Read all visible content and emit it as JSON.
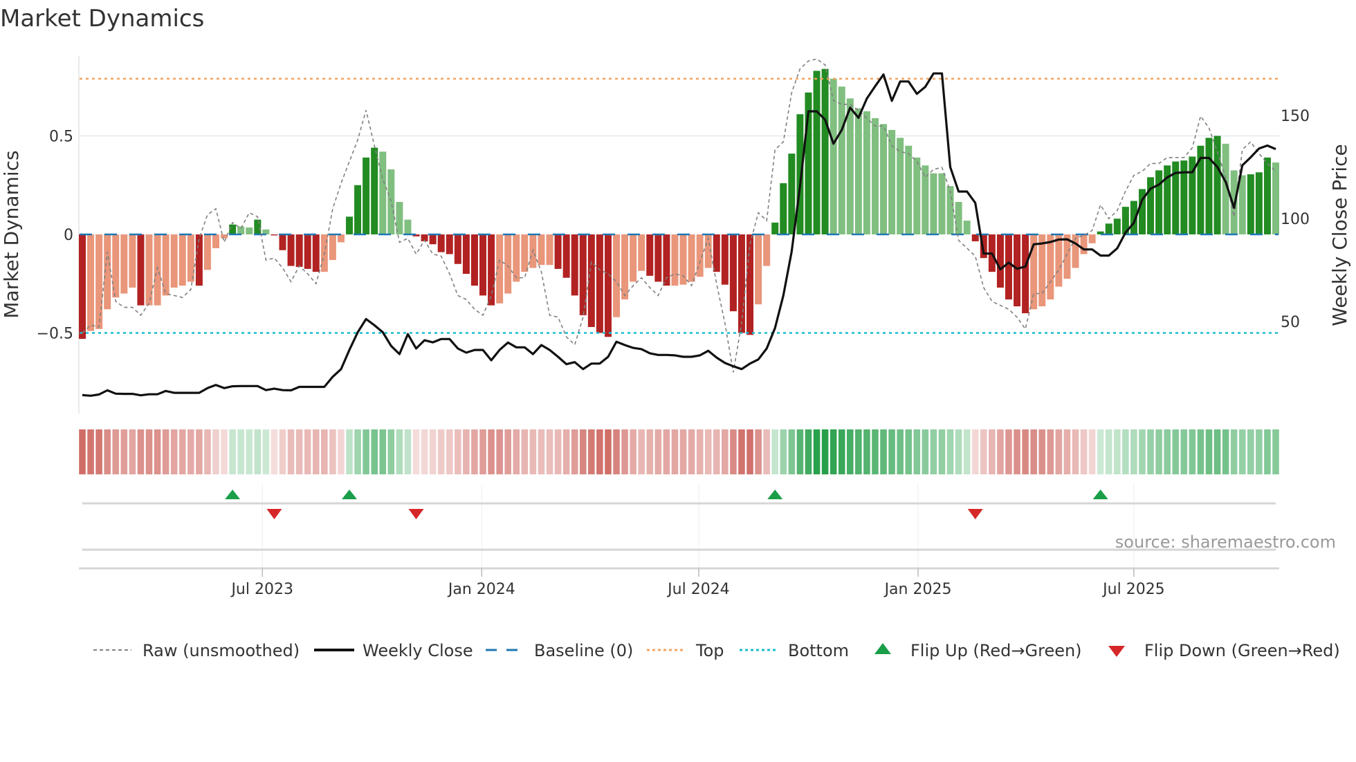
{
  "title": "Market Dynamics",
  "source": "source: sharemaestro.com",
  "colors": {
    "dark_red": "#b22222",
    "light_red": "#e9967a",
    "dark_green": "#228b22",
    "light_green": "#80bf80",
    "raw": "#808080",
    "close": "#111111",
    "baseline": "#1f77b4",
    "top": "#f4a460",
    "bottom": "#17becf",
    "flip_up": "#1a9e48",
    "flip_down": "#d62728"
  },
  "legend": {
    "raw": "Raw (unsmoothed)",
    "close": "Weekly Close",
    "baseline": "Baseline (0)",
    "top": "Top",
    "bottom": "Bottom",
    "flip_up": "Flip Up (Red→Green)",
    "flip_down": "Flip Down (Green→Red)"
  },
  "chart_data": {
    "type": "bar",
    "title": "Market Dynamics",
    "ylabel": "Market Dynamics",
    "y2label": "Weekly Close Price",
    "ylim": [
      -0.95,
      0.92
    ],
    "y2lim": [
      7,
      182
    ],
    "yticks": [
      {
        "v": 0.5,
        "label": "0.5"
      },
      {
        "v": 0,
        "label": "0"
      },
      {
        "v": -0.5,
        "label": "−0.5"
      }
    ],
    "y2ticks": [
      {
        "v": 150,
        "label": "150"
      },
      {
        "v": 100,
        "label": "100"
      },
      {
        "v": 50,
        "label": "50"
      }
    ],
    "xticks": [
      {
        "date": "2023-07-01",
        "label": "Jul 2023"
      },
      {
        "date": "2024-01-01",
        "label": "Jan 2024"
      },
      {
        "date": "2024-07-01",
        "label": "Jul 2024"
      },
      {
        "date": "2025-01-01",
        "label": "Jan 2025"
      },
      {
        "date": "2025-07-01",
        "label": "Jul 2025"
      }
    ],
    "start_week": "2023-01-31",
    "frequency_days": 7,
    "baseline": 0,
    "top": 0.79,
    "bottom": -0.5,
    "smoothed": [
      -0.53,
      -0.49,
      -0.48,
      -0.38,
      -0.32,
      -0.3,
      -0.27,
      -0.36,
      -0.36,
      -0.36,
      -0.31,
      -0.27,
      -0.26,
      -0.24,
      -0.26,
      -0.18,
      -0.07,
      -0.02,
      0.05,
      0.04,
      0.035,
      0.075,
      0.025,
      -0.005,
      -0.08,
      -0.16,
      -0.165,
      -0.175,
      -0.19,
      -0.19,
      -0.13,
      -0.04,
      0.09,
      0.25,
      0.39,
      0.44,
      0.42,
      0.33,
      0.165,
      0.075,
      -0.01,
      -0.035,
      -0.05,
      -0.09,
      -0.1,
      -0.15,
      -0.2,
      -0.26,
      -0.31,
      -0.36,
      -0.35,
      -0.3,
      -0.24,
      -0.19,
      -0.17,
      -0.155,
      -0.155,
      -0.175,
      -0.22,
      -0.31,
      -0.41,
      -0.47,
      -0.5,
      -0.52,
      -0.42,
      -0.33,
      -0.24,
      -0.185,
      -0.21,
      -0.24,
      -0.26,
      -0.26,
      -0.255,
      -0.24,
      -0.215,
      -0.17,
      -0.19,
      -0.255,
      -0.39,
      -0.5,
      -0.51,
      -0.355,
      -0.16,
      0.06,
      0.26,
      0.41,
      0.61,
      0.72,
      0.83,
      0.84,
      0.79,
      0.75,
      0.69,
      0.64,
      0.625,
      0.59,
      0.56,
      0.53,
      0.49,
      0.45,
      0.39,
      0.35,
      0.31,
      0.31,
      0.245,
      0.165,
      0.07,
      -0.035,
      -0.12,
      -0.19,
      -0.27,
      -0.33,
      -0.365,
      -0.4,
      -0.38,
      -0.365,
      -0.33,
      -0.265,
      -0.225,
      -0.17,
      -0.1,
      -0.045,
      0.015,
      0.055,
      0.08,
      0.14,
      0.17,
      0.23,
      0.29,
      0.325,
      0.35,
      0.37,
      0.375,
      0.395,
      0.45,
      0.49,
      0.5,
      0.46,
      0.325,
      0.3,
      0.305,
      0.315,
      0.39,
      0.365
    ],
    "raw": [
      -0.5,
      -0.46,
      -0.47,
      -0.09,
      -0.34,
      -0.37,
      -0.37,
      -0.41,
      -0.35,
      -0.17,
      -0.3,
      -0.31,
      -0.32,
      -0.28,
      -0.02,
      0.1,
      0.13,
      -0.04,
      0.06,
      0.03,
      0.11,
      0.09,
      -0.13,
      -0.12,
      -0.17,
      -0.24,
      -0.16,
      -0.2,
      -0.25,
      -0.1,
      0.13,
      0.26,
      0.37,
      0.48,
      0.63,
      0.45,
      0.28,
      0.17,
      -0.04,
      -0.02,
      -0.1,
      -0.03,
      -0.1,
      -0.11,
      -0.2,
      -0.31,
      -0.33,
      -0.38,
      -0.41,
      -0.31,
      -0.13,
      -0.16,
      -0.22,
      -0.22,
      -0.08,
      -0.19,
      -0.41,
      -0.42,
      -0.52,
      -0.56,
      -0.42,
      -0.14,
      -0.18,
      -0.2,
      -0.24,
      -0.31,
      -0.26,
      -0.22,
      -0.27,
      -0.31,
      -0.22,
      -0.2,
      -0.21,
      -0.26,
      -0.14,
      -0.02,
      -0.25,
      -0.45,
      -0.7,
      -0.45,
      -0.05,
      0.11,
      0.07,
      0.43,
      0.47,
      0.72,
      0.84,
      0.88,
      0.89,
      0.86,
      0.68,
      0.66,
      0.66,
      0.63,
      0.59,
      0.55,
      0.55,
      0.45,
      0.42,
      0.41,
      0.37,
      0.29,
      0.33,
      0.34,
      0.22,
      -0.03,
      -0.07,
      -0.11,
      -0.27,
      -0.34,
      -0.36,
      -0.38,
      -0.42,
      -0.48,
      -0.3,
      -0.3,
      -0.24,
      -0.18,
      -0.1,
      -0.02,
      -0.005,
      0.02,
      0.15,
      0.08,
      0.12,
      0.22,
      0.3,
      0.32,
      0.36,
      0.36,
      0.39,
      0.39,
      0.39,
      0.44,
      0.6,
      0.54,
      0.42,
      0.29,
      0.09,
      0.43,
      0.47,
      0.41,
      0.36,
      0.32
    ],
    "close": [
      14.3,
      14.0,
      14.6,
      16.6,
      15.0,
      14.9,
      14.9,
      14.2,
      14.7,
      14.7,
      16.3,
      15.4,
      15.4,
      15.4,
      15.4,
      17.7,
      19.2,
      17.7,
      18.6,
      18.7,
      18.7,
      18.7,
      16.7,
      17.4,
      16.7,
      16.6,
      18.3,
      18.3,
      18.3,
      18.3,
      23.2,
      26.9,
      36.2,
      44.8,
      51.2,
      48.2,
      44.8,
      38.2,
      34.2,
      43.9,
      36.9,
      40.9,
      39.9,
      41.5,
      41.5,
      36.9,
      34.9,
      36.2,
      36.2,
      31.2,
      36.2,
      39.8,
      37.5,
      37.5,
      34.2,
      38.6,
      36.2,
      32.9,
      29.3,
      30.3,
      26.9,
      29.6,
      29.6,
      32.9,
      40.2,
      38.6,
      37.2,
      36.6,
      34.6,
      33.8,
      33.8,
      33.6,
      32.9,
      32.9,
      33.6,
      35.8,
      32.5,
      29.9,
      28.3,
      26.9,
      29.6,
      31.6,
      36.9,
      46.8,
      62.7,
      84.0,
      115.8,
      152.0,
      152.0,
      148.0,
      136.3,
      143.0,
      153.8,
      148.9,
      158.2,
      164.2,
      169.9,
      157.1,
      166.5,
      166.5,
      160.5,
      163.9,
      170.4,
      170.4,
      125.0,
      113.1,
      113.1,
      107.6,
      83.0,
      83.0,
      75.3,
      78.6,
      75.6,
      76.7,
      87.5,
      87.9,
      88.6,
      89.8,
      89.9,
      87.9,
      85.0,
      85.0,
      82.0,
      82.0,
      85.5,
      93.2,
      97.9,
      109.1,
      114.5,
      116.4,
      120.0,
      122.1,
      122.4,
      122.4,
      129.4,
      129.4,
      125.0,
      117.8,
      105.2,
      125.8,
      129.7,
      134.0,
      135.4,
      133.7
    ]
  }
}
